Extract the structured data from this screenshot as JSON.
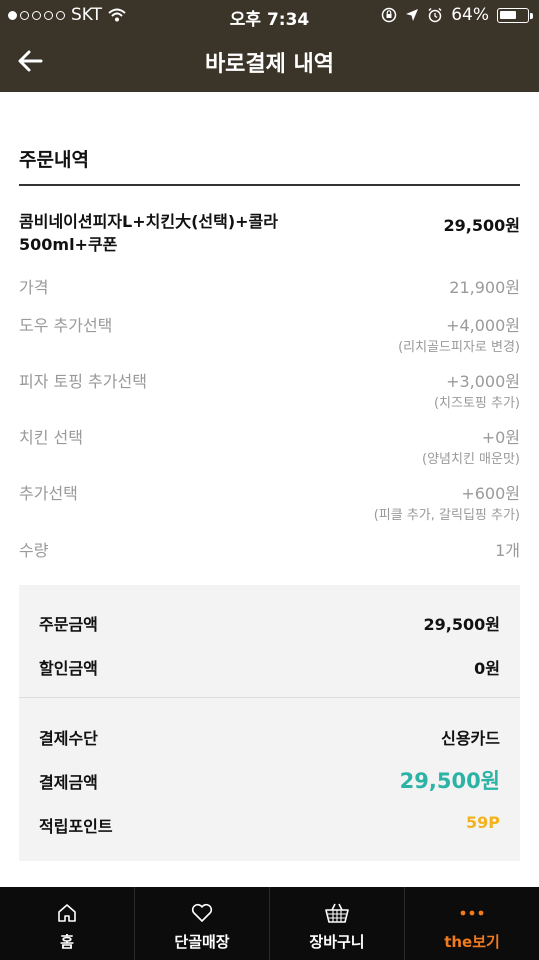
{
  "status": {
    "carrier": "SKT",
    "time": "오후 7:34",
    "battery": "64%",
    "battery_level": 0.64
  },
  "header": {
    "title": "바로결제 내역"
  },
  "order": {
    "section_title": "주문내역",
    "product_name": "콤비네이션피자L+치킨大(선택)+콜라500ml+쿠폰",
    "product_price": "29,500원",
    "options": [
      {
        "label": "가격",
        "value": "21,900원",
        "note": ""
      },
      {
        "label": "도우 추가선택",
        "value": "+4,000원",
        "note": "(리치골드피자로 변경)"
      },
      {
        "label": "피자 토핑 추가선택",
        "value": "+3,000원",
        "note": "(치즈토핑 추가)"
      },
      {
        "label": "치킨 선택",
        "value": "+0원",
        "note": "(양념치킨 매운맛)"
      },
      {
        "label": "추가선택",
        "value": "+600원",
        "note": "(피클 추가, 갈릭딥핑 추가)"
      },
      {
        "label": "수량",
        "value": "1개",
        "note": ""
      }
    ]
  },
  "summary": {
    "order_amount_label": "주문금액",
    "order_amount": "29,500원",
    "discount_label": "할인금액",
    "discount": "0원",
    "payment_method_label": "결제수단",
    "payment_method": "신용카드",
    "payment_amount_label": "결제금액",
    "payment_amount": "29,500원",
    "points_label": "적립포인트",
    "points": "59P"
  },
  "tabs": [
    {
      "label": "홈",
      "icon": "home-icon"
    },
    {
      "label": "단골매장",
      "icon": "heart-icon"
    },
    {
      "label": "장바구니",
      "icon": "basket-icon"
    },
    {
      "label": "the보기",
      "icon": "more-dots-icon"
    }
  ],
  "colors": {
    "header_bg": "#3b3429",
    "total_accent": "#2bb3a5",
    "points_accent": "#f3b31d",
    "active_tab": "#f07a1e"
  }
}
